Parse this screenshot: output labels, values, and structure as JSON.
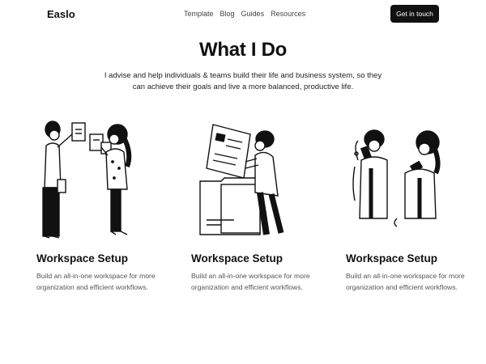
{
  "nav": {
    "logo": "Easlo",
    "links": [
      "Template",
      "Blog",
      "Guides",
      "Resources"
    ],
    "cta": "Get in touch"
  },
  "hero": {
    "title": "What I Do",
    "lead": "I advise and help individuals & teams build their life and business system, so they can achieve their goals and live a more balanced, productive life."
  },
  "cards": [
    {
      "illustration": "two-people-planning-board",
      "title": "Workspace Setup",
      "desc": "Build an all-in-one workspace for more organization and efficient workflows."
    },
    {
      "illustration": "person-with-documents-folder",
      "title": "Workspace Setup",
      "desc": "Build an all-in-one workspace for more organization and efficient workflows."
    },
    {
      "illustration": "two-people-on-phones",
      "title": "Workspace Setup",
      "desc": "Build an all-in-one workspace for more organization and efficient workflows."
    }
  ],
  "colors": {
    "primary": "#111111",
    "button_text": "#ffffff",
    "body_text": "#555555"
  }
}
